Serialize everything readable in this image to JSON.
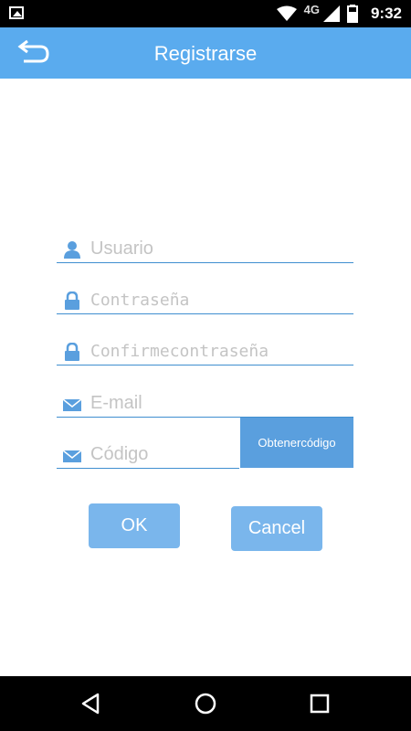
{
  "status_bar": {
    "time": "9:32",
    "network": "4G",
    "icons": [
      "image-icon",
      "wifi-icon",
      "signal-icon",
      "battery-icon"
    ]
  },
  "app_bar": {
    "title": "Registrarse",
    "back_icon": "back-arrow-icon",
    "background_color": "#5aabee"
  },
  "form": {
    "username": {
      "placeholder": "Usuario",
      "value": "",
      "icon": "user-icon"
    },
    "password": {
      "placeholder": "Contraseña",
      "value": "",
      "icon": "lock-icon"
    },
    "confirm_password": {
      "placeholder": "Confirmecontraseña",
      "value": "",
      "icon": "lock-icon"
    },
    "email": {
      "placeholder": "E-mail",
      "value": "",
      "icon": "mail-icon"
    },
    "code": {
      "placeholder": "Código",
      "value": "",
      "icon": "mail-icon"
    },
    "get_code_label": "Obtenercódigo"
  },
  "buttons": {
    "ok_label": "OK",
    "cancel_label": "Cancel"
  },
  "nav_bar": {
    "icons": [
      "back-triangle-icon",
      "home-circle-icon",
      "recents-square-icon"
    ]
  }
}
